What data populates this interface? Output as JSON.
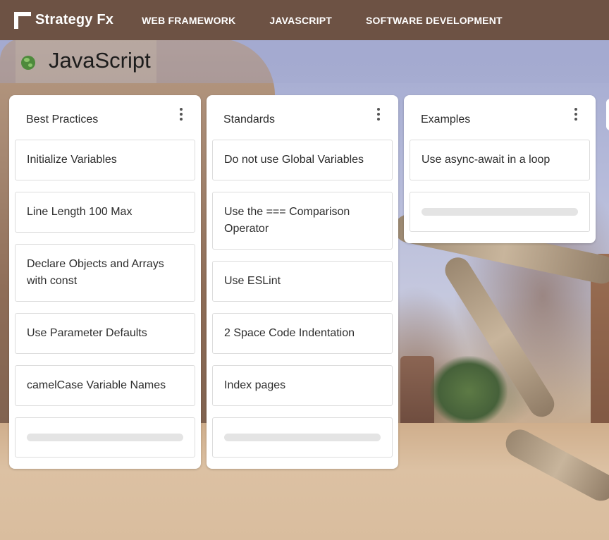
{
  "app": {
    "brand": "Strategy Fx",
    "nav": [
      {
        "label": "WEB FRAMEWORK"
      },
      {
        "label": "JAVASCRIPT"
      },
      {
        "label": "SOFTWARE DEVELOPMENT"
      }
    ]
  },
  "board": {
    "title": "JavaScript",
    "icon": "globe-icon"
  },
  "lists": [
    {
      "title": "Best Practices",
      "cards": [
        "Initialize Variables",
        "Line Length 100 Max",
        "Declare Objects and Arrays with const",
        "Use Parameter Defaults",
        "camelCase Variable Names"
      ]
    },
    {
      "title": "Standards",
      "cards": [
        "Do not use Global Variables",
        "Use the === Comparison Operator",
        "Use ESLint",
        "2 Space Code Indentation",
        "Index pages"
      ]
    },
    {
      "title": "Examples",
      "cards": [
        "Use async-await in a loop"
      ]
    }
  ],
  "colors": {
    "topbar": "#6d5244",
    "card_border": "#dcdcdc",
    "placeholder_bar": "#e4e4e4"
  }
}
